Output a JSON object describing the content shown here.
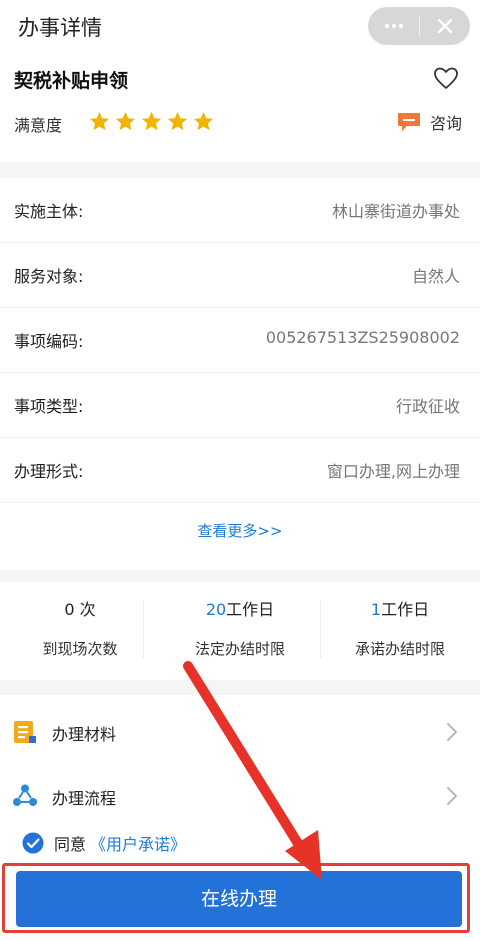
{
  "header": {
    "title": "办事详情",
    "more_icon": "more-dots-icon",
    "close_icon": "close-icon"
  },
  "service": {
    "title": "契税补贴申领",
    "favorite_icon": "heart-icon",
    "satisfaction_label": "满意度",
    "stars": 5,
    "consult_label": "咨询",
    "consult_icon": "chat-bubble-icon"
  },
  "details": [
    {
      "label": "实施主体:",
      "value": "林山寨街道办事处"
    },
    {
      "label": "服务对象:",
      "value": "自然人"
    },
    {
      "label": "事项编码:",
      "value": "005267513ZS25908002"
    },
    {
      "label": "事项类型:",
      "value": "行政征收"
    },
    {
      "label": "办理形式:",
      "value": "窗口办理,网上办理"
    }
  ],
  "view_more": "查看更多>>",
  "stats": [
    {
      "num": "0",
      "unit": " 次",
      "caption": "到现场次数"
    },
    {
      "num": "20",
      "unit": "工作日",
      "caption": "法定办结时限"
    },
    {
      "num": "1",
      "unit": "工作日",
      "caption": "承诺办结时限"
    }
  ],
  "links": [
    {
      "label": "办理材料",
      "icon": "document-icon"
    },
    {
      "label": "办理流程",
      "icon": "flow-icon"
    }
  ],
  "agreement": {
    "prefix": "同意",
    "link": "《用户承诺》",
    "checked": true
  },
  "submit_button": "在线办理",
  "colors": {
    "accent": "#1e7bd6",
    "button": "#2471d8",
    "star": "#f2b400",
    "highlight": "#e0413a"
  }
}
